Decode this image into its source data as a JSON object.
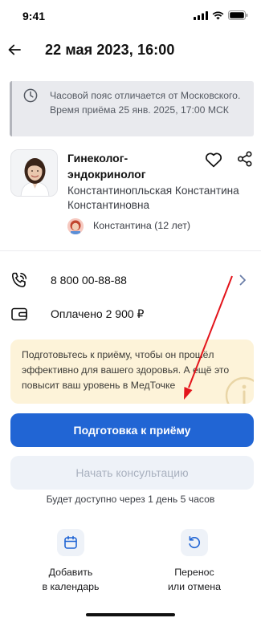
{
  "status_bar": {
    "time": "9:41"
  },
  "header": {
    "title": "22 мая 2023, 16:00"
  },
  "timezone_notice": {
    "text": "Часовой пояс отличается от Московского. Время приёма 25 янв. 2025, 17:00 МСК"
  },
  "doctor": {
    "specialty": "Гинеколог-эндокринолог",
    "name": "Константинопльская Константина Константиновна"
  },
  "patient": {
    "label": "Константина (12 лет)"
  },
  "contact": {
    "phone": "8 800 00-88-88"
  },
  "payment": {
    "label": "Оплачено 2 900 ₽"
  },
  "prep_card": {
    "text": "Подготовьтесь к приёму, чтобы он прошёл эффективно для вашего здоровья. А ещё это повысит ваш уровень в МедТочке"
  },
  "buttons": {
    "prepare": "Подготовка к приёму",
    "start": "Начать консультацию"
  },
  "availability": {
    "text": "Будет доступно через 1 день 5 часов"
  },
  "actions": {
    "calendar": "Добавить\nв календарь",
    "reschedule": "Перенос\nили отмена"
  },
  "colors": {
    "primary": "#2165d4",
    "banner_bg": "#e9eaee",
    "prep_bg": "#fdf3d9",
    "annotation_arrow": "#e3141b"
  },
  "icons": [
    "back-arrow-icon",
    "clock-icon",
    "heart-icon",
    "share-icon",
    "phone-icon",
    "wallet-icon",
    "chevron-right-icon",
    "info-icon",
    "calendar-icon",
    "refresh-icon"
  ]
}
